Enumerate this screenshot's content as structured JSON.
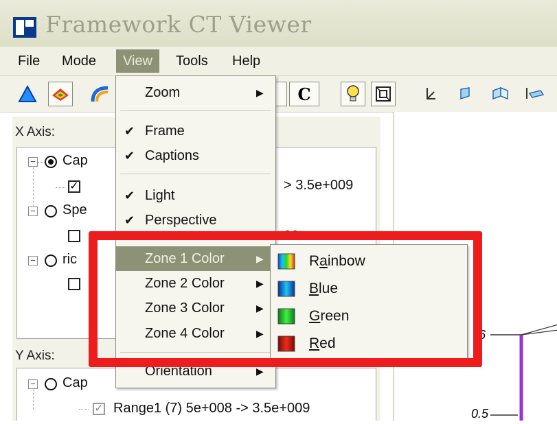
{
  "window": {
    "title": "Framework CT Viewer",
    "icon": "app-window-icon"
  },
  "menubar": {
    "items": [
      {
        "label": "File"
      },
      {
        "label": "Mode"
      },
      {
        "label": "View"
      },
      {
        "label": "Tools"
      },
      {
        "label": "Help"
      }
    ],
    "active": "View"
  },
  "toolbar": {
    "buttons": [
      "triangle-icon",
      "surface-icon",
      "gradient-icon",
      "bracket-icon",
      "c-button",
      "lightbulb-icon",
      "frame-icon",
      "axis-icon-1",
      "axis-icon-2",
      "axis-icon-3",
      "axis-icon-4"
    ],
    "c_label": "C"
  },
  "left_panel": {
    "x_axis_label": "X Axis:",
    "y_axis_label": "Y Axis:",
    "x_tree": [
      {
        "label": "Cap",
        "range": "> 3.5e+009"
      },
      {
        "label": "Spe",
        "range": "00"
      },
      {
        "label": "ric"
      }
    ],
    "y_tree": [
      {
        "label": "Cap"
      },
      {
        "label": "Range1 (7)  5e+008  ->  3.5e+009"
      }
    ]
  },
  "view_menu": {
    "zoom": "Zoom",
    "frame": "Frame",
    "captions": "Captions",
    "light": "Light",
    "perspective": "Perspective",
    "zone1": "Zone 1 Color",
    "zone2": "Zone 2 Color",
    "zone3": "Zone 3 Color",
    "zone4": "Zone 4 Color",
    "orientation": "Orientation"
  },
  "zone_color_submenu": [
    {
      "label": "Rainbow",
      "accel": "a",
      "swatch": "rainbow"
    },
    {
      "label": "Blue",
      "accel": "B",
      "swatch": "blue"
    },
    {
      "label": "Green",
      "accel": "G",
      "swatch": "green"
    },
    {
      "label": "Red",
      "accel": "R",
      "swatch": "red"
    }
  ],
  "chart": {
    "tick_top": ".6",
    "tick_bottom": "0.5"
  },
  "colors": {
    "menu_highlight": "#8d9276",
    "annotation": "#ee1c1c",
    "axis_line": "#9b30d9"
  }
}
